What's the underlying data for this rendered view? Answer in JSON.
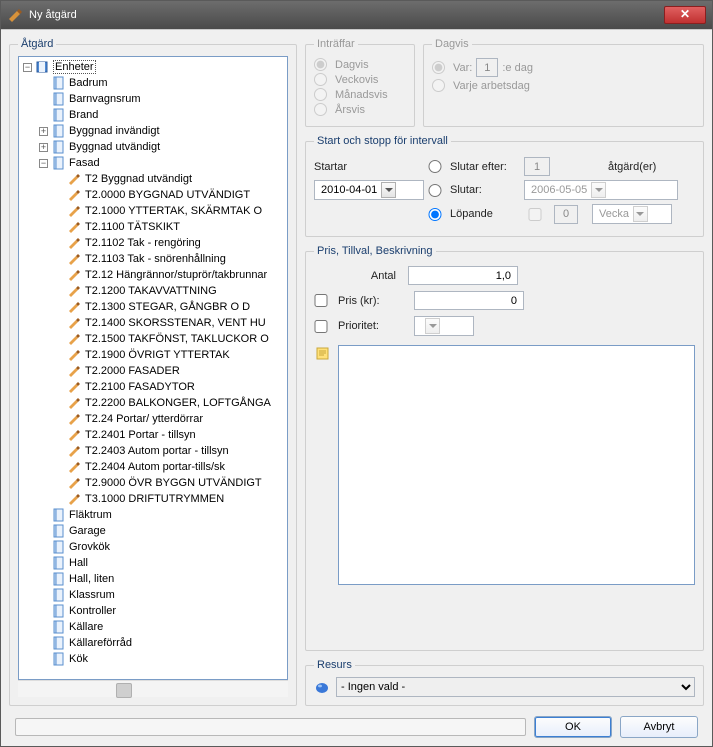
{
  "window": {
    "title": "Ny åtgärd"
  },
  "left": {
    "legend": "Åtgärd",
    "root": "Enheter",
    "folders_top": [
      "Badrum",
      "Barnvagnsrum",
      "Brand",
      "Byggnad invändigt",
      "Byggnad utvändigt"
    ],
    "fasad": "Fasad",
    "fasad_items": [
      "T2 Byggnad utvändigt",
      "T2.0000 BYGGNAD UTVÄNDIGT",
      "T2.1000 YTTERTAK, SKÄRMTAK O",
      "T2.1100 TÄTSKIKT",
      "T2.1102 Tak - rengöring",
      "T2.1103 Tak - snörenhållning",
      "T2.12 Hängrännor/stuprör/takbrunnar",
      "T2.1200 TAKAVVATTNING",
      "T2.1300 STEGAR, GÅNGBR O D",
      "T2.1400 SKORSSTENAR, VENT HU",
      "T2.1500 TAKFÖNST, TAKLUCKOR O",
      "T2.1900 ÖVRIGT YTTERTAK",
      "T2.2000 FASADER",
      "T2.2100 FASADYTOR",
      "T2.2200 BALKONGER, LOFTGÅNGA",
      "T2.24 Portar/ ytterdörrar",
      "T2.2401 Portar - tillsyn",
      "T2.2403 Autom portar - tillsyn",
      "T2.2404 Autom portar-tills/sk",
      "T2.9000 ÖVR BYGGN UTVÄNDIGT",
      "T3.1000 DRIFTUTRYMMEN"
    ],
    "folders_bottom": [
      "Fläktrum",
      "Garage",
      "Grovkök",
      "Hall",
      "Hall, liten",
      "Klassrum",
      "Kontroller",
      "Källare",
      "Källareförråd",
      "Kök"
    ]
  },
  "intraffar": {
    "legend": "Inträffar",
    "dagvis": "Dagvis",
    "veckovis": "Veckovis",
    "manadsvis": "Månadsvis",
    "arsvis": "Årsvis"
  },
  "dagvis": {
    "legend": "Dagvis",
    "var": "Var:",
    "var_val": "1",
    "var_suffix": ":e dag",
    "varje": "Varje arbetsdag"
  },
  "startstop": {
    "legend": "Start och stopp för intervall",
    "startar": "Startar",
    "start_date": "2010-04-01",
    "slutar_efter": "Slutar efter:",
    "slutar_efter_val": "1",
    "slutar_efter_unit": "åtgärd(er)",
    "slutar": "Slutar:",
    "slutar_date": "2006-05-05",
    "lopande": "Löpande",
    "lop_val": "0",
    "lop_unit": "Vecka"
  },
  "pris": {
    "legend": "Pris, Tillval, Beskrivning",
    "antal": "Antal",
    "antal_val": "1,0",
    "pris_kr": "Pris (kr):",
    "pris_val": "0",
    "prioritet": "Prioritet:"
  },
  "resurs": {
    "legend": "Resurs",
    "value": "- Ingen vald -"
  },
  "buttons": {
    "ok": "OK",
    "cancel": "Avbryt"
  }
}
